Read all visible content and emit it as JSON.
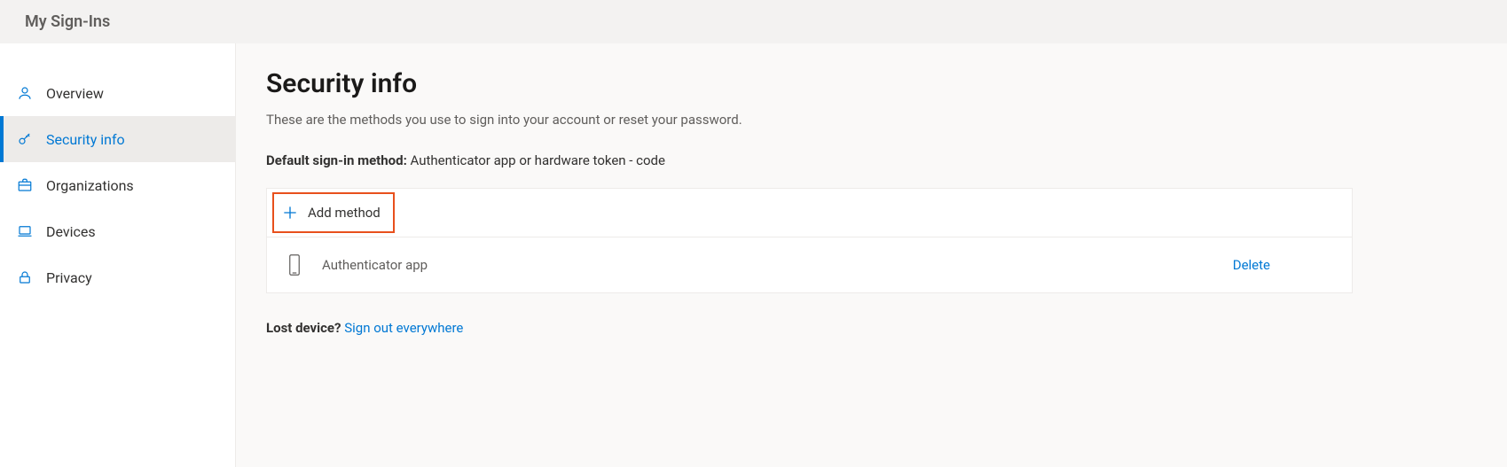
{
  "topbar": {
    "title": "My Sign-Ins"
  },
  "sidebar": {
    "items": [
      {
        "label": "Overview"
      },
      {
        "label": "Security info"
      },
      {
        "label": "Organizations"
      },
      {
        "label": "Devices"
      },
      {
        "label": "Privacy"
      }
    ]
  },
  "main": {
    "title": "Security info",
    "subtitle": "These are the methods you use to sign into your account or reset your password.",
    "default_label": "Default sign-in method:",
    "default_value": "Authenticator app or hardware token - code",
    "add_method_label": "Add method",
    "methods": [
      {
        "label": "Authenticator app",
        "action": "Delete"
      }
    ],
    "lost_device_q": "Lost device?",
    "sign_out_label": "Sign out everywhere"
  },
  "colors": {
    "accent": "#0078d4",
    "highlight_border": "#e8501c"
  }
}
